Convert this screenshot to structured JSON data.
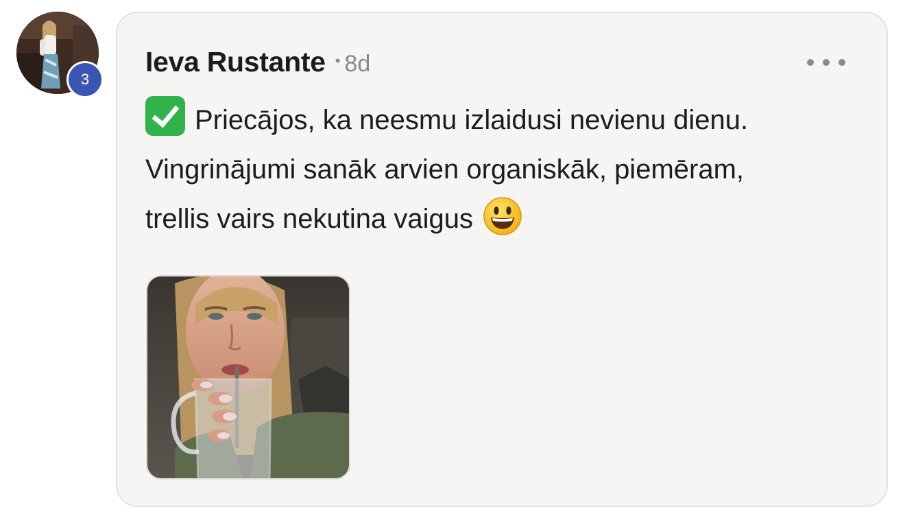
{
  "post": {
    "author": {
      "name": "Ieva Rustante",
      "level": "3",
      "avatar_icon": "user-avatar-photo"
    },
    "separator": "•",
    "time": "8d",
    "menu_icon": "more-horizontal-icon",
    "body": {
      "leading_emoji": "white-heavy-check-mark-emoji",
      "line1": "Priecājos, ka neesmu izlaidusi nevienu dienu.",
      "line2": "Vingrinājumi sanāk arvien organiskāk, piemēram,",
      "line3": "trellis vairs nekutina vaigus",
      "trailing_emoji": "smiling-face-with-open-mouth-emoji"
    },
    "attachment": {
      "type": "image",
      "description_icon": "attached-photo-thumbnail"
    }
  },
  "colors": {
    "card_background": "#f6f5f3",
    "card_border": "#e3e2df",
    "level_badge": "#3a56b3",
    "text_primary": "#1c1c1c",
    "text_secondary": "#8a8a8a",
    "check_green": "#2fb34a"
  }
}
